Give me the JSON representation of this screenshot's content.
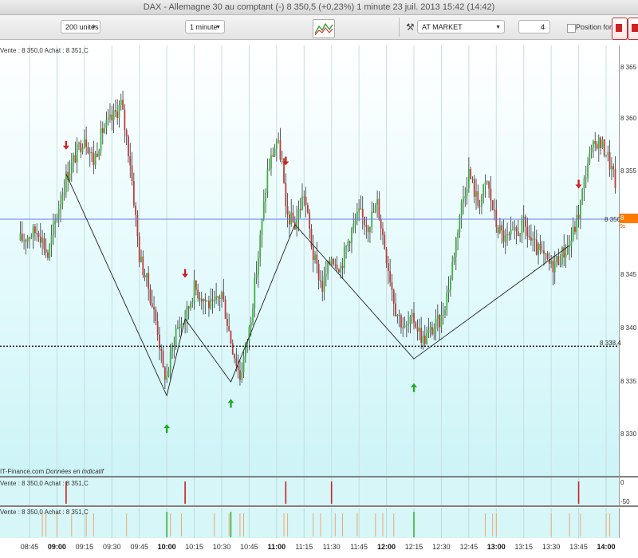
{
  "window": {
    "title": "DAX - Allemagne 30 au comptant (-)    8 350,5 (+0,23%)    1 minute   23 juil. 2013 15:42 (14:42)"
  },
  "toolbar": {
    "units_select": "200 unités",
    "timeframe_select": "1 minute",
    "order_type_select": "AT MARKET",
    "quantity_value": "4",
    "position_forcee_label": "Position forcée",
    "colors": {
      "buy": "#22aa22",
      "sell": "#cc2222"
    }
  },
  "main_pane": {
    "info_label": "Vente : 8 350,0 Achat : 8 351,C",
    "credit_source": "IT-Finance.com",
    "credit_note": "Données en indicatif",
    "current_price": "8 350,5",
    "current_price_sub": "9s",
    "current_price_axis": "8 350",
    "horizontal_level": "8 338,4",
    "y_axis_labels": [
      "8 365",
      "8 360",
      "8 355",
      "8 350",
      "8 345",
      "8 340",
      "8 335",
      "8 330"
    ]
  },
  "indicator_pane": {
    "info_label": "Vente : 8 350,0 Achat : 8 351,C",
    "y_axis_labels": [
      "0",
      "-50"
    ]
  },
  "volume_pane": {
    "info_label": "Vente : 8 350,0 Achat : 8 351,C"
  },
  "x_axis_labels": [
    {
      "label": "08:45",
      "bold": false
    },
    {
      "label": "09:00",
      "bold": true
    },
    {
      "label": "09:15",
      "bold": false
    },
    {
      "label": "09:30",
      "bold": false
    },
    {
      "label": "09:45",
      "bold": false
    },
    {
      "label": "10:00",
      "bold": true
    },
    {
      "label": "10:15",
      "bold": false
    },
    {
      "label": "10:30",
      "bold": false
    },
    {
      "label": "10:45",
      "bold": false
    },
    {
      "label": "11:00",
      "bold": true
    },
    {
      "label": "11:15",
      "bold": false
    },
    {
      "label": "11:30",
      "bold": false
    },
    {
      "label": "11:45",
      "bold": false
    },
    {
      "label": "12:00",
      "bold": true
    },
    {
      "label": "12:15",
      "bold": false
    },
    {
      "label": "12:30",
      "bold": false
    },
    {
      "label": "12:45",
      "bold": false
    },
    {
      "label": "13:00",
      "bold": true
    },
    {
      "label": "13:15",
      "bold": false
    },
    {
      "label": "13:30",
      "bold": false
    },
    {
      "label": "13:45",
      "bold": false
    },
    {
      "label": "14:00",
      "bold": true
    }
  ],
  "chart_data": {
    "type": "candlestick",
    "x_start": "08:40",
    "x_end": "14:05",
    "ylim": [
      8328,
      8367
    ],
    "current_price_line": 8350.5,
    "level_line": 8338.4,
    "close_path": [
      [
        "08:40",
        8348.5
      ],
      [
        "08:45",
        8349
      ],
      [
        "08:50",
        8349.5
      ],
      [
        "08:55",
        8347
      ],
      [
        "09:00",
        8351
      ],
      [
        "09:05",
        8354.5
      ],
      [
        "09:10",
        8356.5
      ],
      [
        "09:15",
        8358.5
      ],
      [
        "09:20",
        8356
      ],
      [
        "09:25",
        8359
      ],
      [
        "09:30",
        8360
      ],
      [
        "09:35",
        8361.5
      ],
      [
        "09:40",
        8356
      ],
      [
        "09:45",
        8347
      ],
      [
        "09:50",
        8344
      ],
      [
        "09:55",
        8340
      ],
      [
        "09:58",
        8336
      ],
      [
        "10:00",
        8335.5
      ],
      [
        "10:05",
        8340
      ],
      [
        "10:10",
        8341
      ],
      [
        "10:15",
        8344
      ],
      [
        "10:20",
        8343
      ],
      [
        "10:25",
        8342
      ],
      [
        "10:30",
        8343.5
      ],
      [
        "10:35",
        8339
      ],
      [
        "10:40",
        8335.5
      ],
      [
        "10:45",
        8340
      ],
      [
        "10:50",
        8347
      ],
      [
        "10:55",
        8355
      ],
      [
        "11:00",
        8358
      ],
      [
        "11:03",
        8356
      ],
      [
        "11:05",
        8351
      ],
      [
        "11:10",
        8350
      ],
      [
        "11:15",
        8353
      ],
      [
        "11:20",
        8347
      ],
      [
        "11:25",
        8344
      ],
      [
        "11:30",
        8347
      ],
      [
        "11:35",
        8346
      ],
      [
        "11:40",
        8349
      ],
      [
        "11:45",
        8351
      ],
      [
        "11:50",
        8350
      ],
      [
        "11:55",
        8352
      ],
      [
        "12:00",
        8347
      ],
      [
        "12:05",
        8342
      ],
      [
        "12:10",
        8340
      ],
      [
        "12:15",
        8341
      ],
      [
        "12:20",
        8339
      ],
      [
        "12:25",
        8340
      ],
      [
        "12:30",
        8341
      ],
      [
        "12:35",
        8345
      ],
      [
        "12:40",
        8351
      ],
      [
        "12:45",
        8355
      ],
      [
        "12:50",
        8352
      ],
      [
        "12:55",
        8354
      ],
      [
        "13:00",
        8350
      ],
      [
        "13:05",
        8348.5
      ],
      [
        "13:10",
        8349
      ],
      [
        "13:15",
        8350
      ],
      [
        "13:20",
        8348
      ],
      [
        "13:25",
        8347
      ],
      [
        "13:30",
        8346
      ],
      [
        "13:35",
        8347
      ],
      [
        "13:40",
        8348
      ],
      [
        "13:45",
        8351
      ],
      [
        "13:50",
        8356
      ],
      [
        "13:55",
        8358
      ],
      [
        "14:00",
        8357
      ],
      [
        "14:05",
        8354
      ]
    ],
    "zigzag": [
      [
        "09:05",
        8354.8
      ],
      [
        "10:00",
        8333.7
      ],
      [
        "10:10",
        8341
      ],
      [
        "10:35",
        8335
      ],
      [
        "11:10",
        8350
      ],
      [
        "12:15",
        8337.2
      ],
      [
        "13:40",
        8348
      ]
    ],
    "sell_arrows": [
      [
        "09:05",
        8357.5
      ],
      [
        "10:10",
        8345.3
      ],
      [
        "11:05",
        8356
      ],
      [
        "13:45",
        8353.8
      ]
    ],
    "buy_arrows": [
      [
        "10:00",
        8330.6
      ],
      [
        "10:35",
        8333
      ],
      [
        "12:15",
        8334.5
      ]
    ],
    "indicator_sell_markers": [
      "09:05",
      "10:10",
      "11:05",
      "11:30",
      "13:45"
    ],
    "volume_green_markers": [
      "10:00",
      "10:35",
      "12:15"
    ]
  }
}
